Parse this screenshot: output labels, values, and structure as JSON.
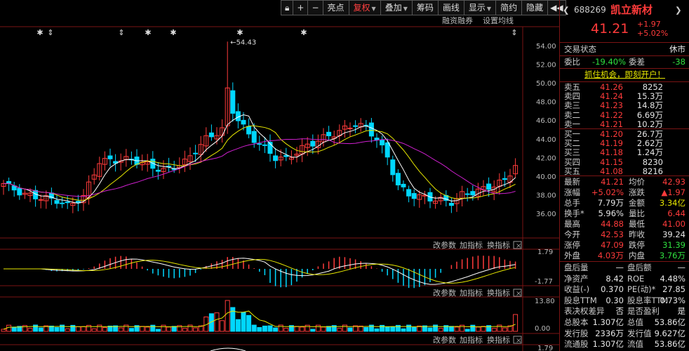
{
  "toolbar": {
    "items": [
      "亮点",
      "复权",
      "叠加",
      "筹码",
      "画线",
      "显示",
      "简约",
      "隐藏"
    ],
    "icons": [
      "lock-icon",
      "plus-icon",
      "minus-icon"
    ]
  },
  "chart_header": {
    "label_1": "融资融券",
    "label_2": "设置均线"
  },
  "price_axis": [
    "54.00",
    "52.00",
    "50.00",
    "48.00",
    "46.00",
    "44.00",
    "42.00",
    "40.00",
    "38.00",
    "36.00"
  ],
  "peak_marker": "54.43",
  "macd_panel": {
    "buttons": [
      "改参数",
      "加指标",
      "换指标"
    ],
    "axis_top": "1.79",
    "axis_bottom": "-1.77"
  },
  "vol_panel": {
    "buttons": [
      "改参数",
      "加指标",
      "换指标"
    ],
    "axis_top": "13.80",
    "axis_bottom": "0.00"
  },
  "bottom_panel": {
    "buttons": [
      "改参数",
      "加指标",
      "换指标"
    ],
    "axis_top": "1.79"
  },
  "stock": {
    "code": "688269",
    "name": "凯立新材",
    "price": "41.21",
    "change": "+1.97",
    "change_pct": "+5.02%"
  },
  "status": {
    "label": "交易状态",
    "value": "休市"
  },
  "committee": {
    "ratio_label": "委比",
    "ratio": "-19.40%",
    "diff_label": "委差",
    "diff": "-38"
  },
  "promo": "抓住机会，即刻开户！",
  "asks": [
    {
      "label": "卖五",
      "price": "41.26",
      "vol": "8252"
    },
    {
      "label": "卖四",
      "price": "41.24",
      "vol": "15.3万"
    },
    {
      "label": "卖三",
      "price": "41.23",
      "vol": "14.8万"
    },
    {
      "label": "卖二",
      "price": "41.22",
      "vol": "6.69万"
    },
    {
      "label": "卖一",
      "price": "41.21",
      "vol": "10.2万"
    }
  ],
  "bids": [
    {
      "label": "买一",
      "price": "41.20",
      "vol": "26.7万"
    },
    {
      "label": "买二",
      "price": "41.19",
      "vol": "2.62万"
    },
    {
      "label": "买三",
      "price": "41.18",
      "vol": "1.24万"
    },
    {
      "label": "买四",
      "price": "41.15",
      "vol": "8230"
    },
    {
      "label": "买五",
      "price": "41.08",
      "vol": "8216"
    }
  ],
  "stats": [
    {
      "l1": "最新",
      "v1": "41.21",
      "c1": "red",
      "l2": "均价",
      "v2": "42.93",
      "c2": "red"
    },
    {
      "l1": "涨幅",
      "v1": "+5.02%",
      "c1": "red",
      "l2": "涨跌",
      "v2": "▲1.97",
      "c2": "red"
    },
    {
      "l1": "总手",
      "v1": "7.79万",
      "c1": "wht",
      "l2": "金额",
      "v2": "3.34亿",
      "c2": "ylw"
    },
    {
      "l1": "换手*",
      "v1": "5.96%",
      "c1": "wht",
      "l2": "量比",
      "v2": "6.44",
      "c2": "red"
    },
    {
      "l1": "最高",
      "v1": "44.88",
      "c1": "red",
      "l2": "最低",
      "v2": "41.00",
      "c2": "red"
    },
    {
      "l1": "今开",
      "v1": "42.53",
      "c1": "red",
      "l2": "昨收",
      "v2": "39.24",
      "c2": "wht"
    },
    {
      "l1": "涨停",
      "v1": "47.09",
      "c1": "red",
      "l2": "跌停",
      "v2": "31.39",
      "c2": "grn"
    },
    {
      "l1": "外盘",
      "v1": "4.03万",
      "c1": "red",
      "l2": "内盘",
      "v2": "3.76万",
      "c2": "grn"
    }
  ],
  "fundamentals": [
    {
      "l1": "盘后量",
      "v1": "—",
      "l2": "盘后额",
      "v2": "—"
    },
    {
      "l1": "净资产",
      "v1": "8.42",
      "l2": "ROE",
      "v2": "4.48%"
    },
    {
      "l1": "收益(-)",
      "v1": "0.370",
      "l2": "PE(动)*",
      "v2": "27.85"
    },
    {
      "l1": "股息TTM",
      "v1": "0.30",
      "l2": "股息率TTM",
      "v2": "0.73%"
    },
    {
      "l1": "表决权差异",
      "v1": "否",
      "l2": "是否盈利",
      "v2": "是"
    },
    {
      "l1": "总股本",
      "v1": "1.307亿",
      "l2": "总值",
      "v2": "53.86亿"
    },
    {
      "l1": "发行股",
      "v1": "2336万",
      "l2": "发行值",
      "v2": "9.627亿"
    },
    {
      "l1": "流通股",
      "v1": "1.307亿",
      "l2": "流值",
      "v2": "53.86亿"
    }
  ]
}
